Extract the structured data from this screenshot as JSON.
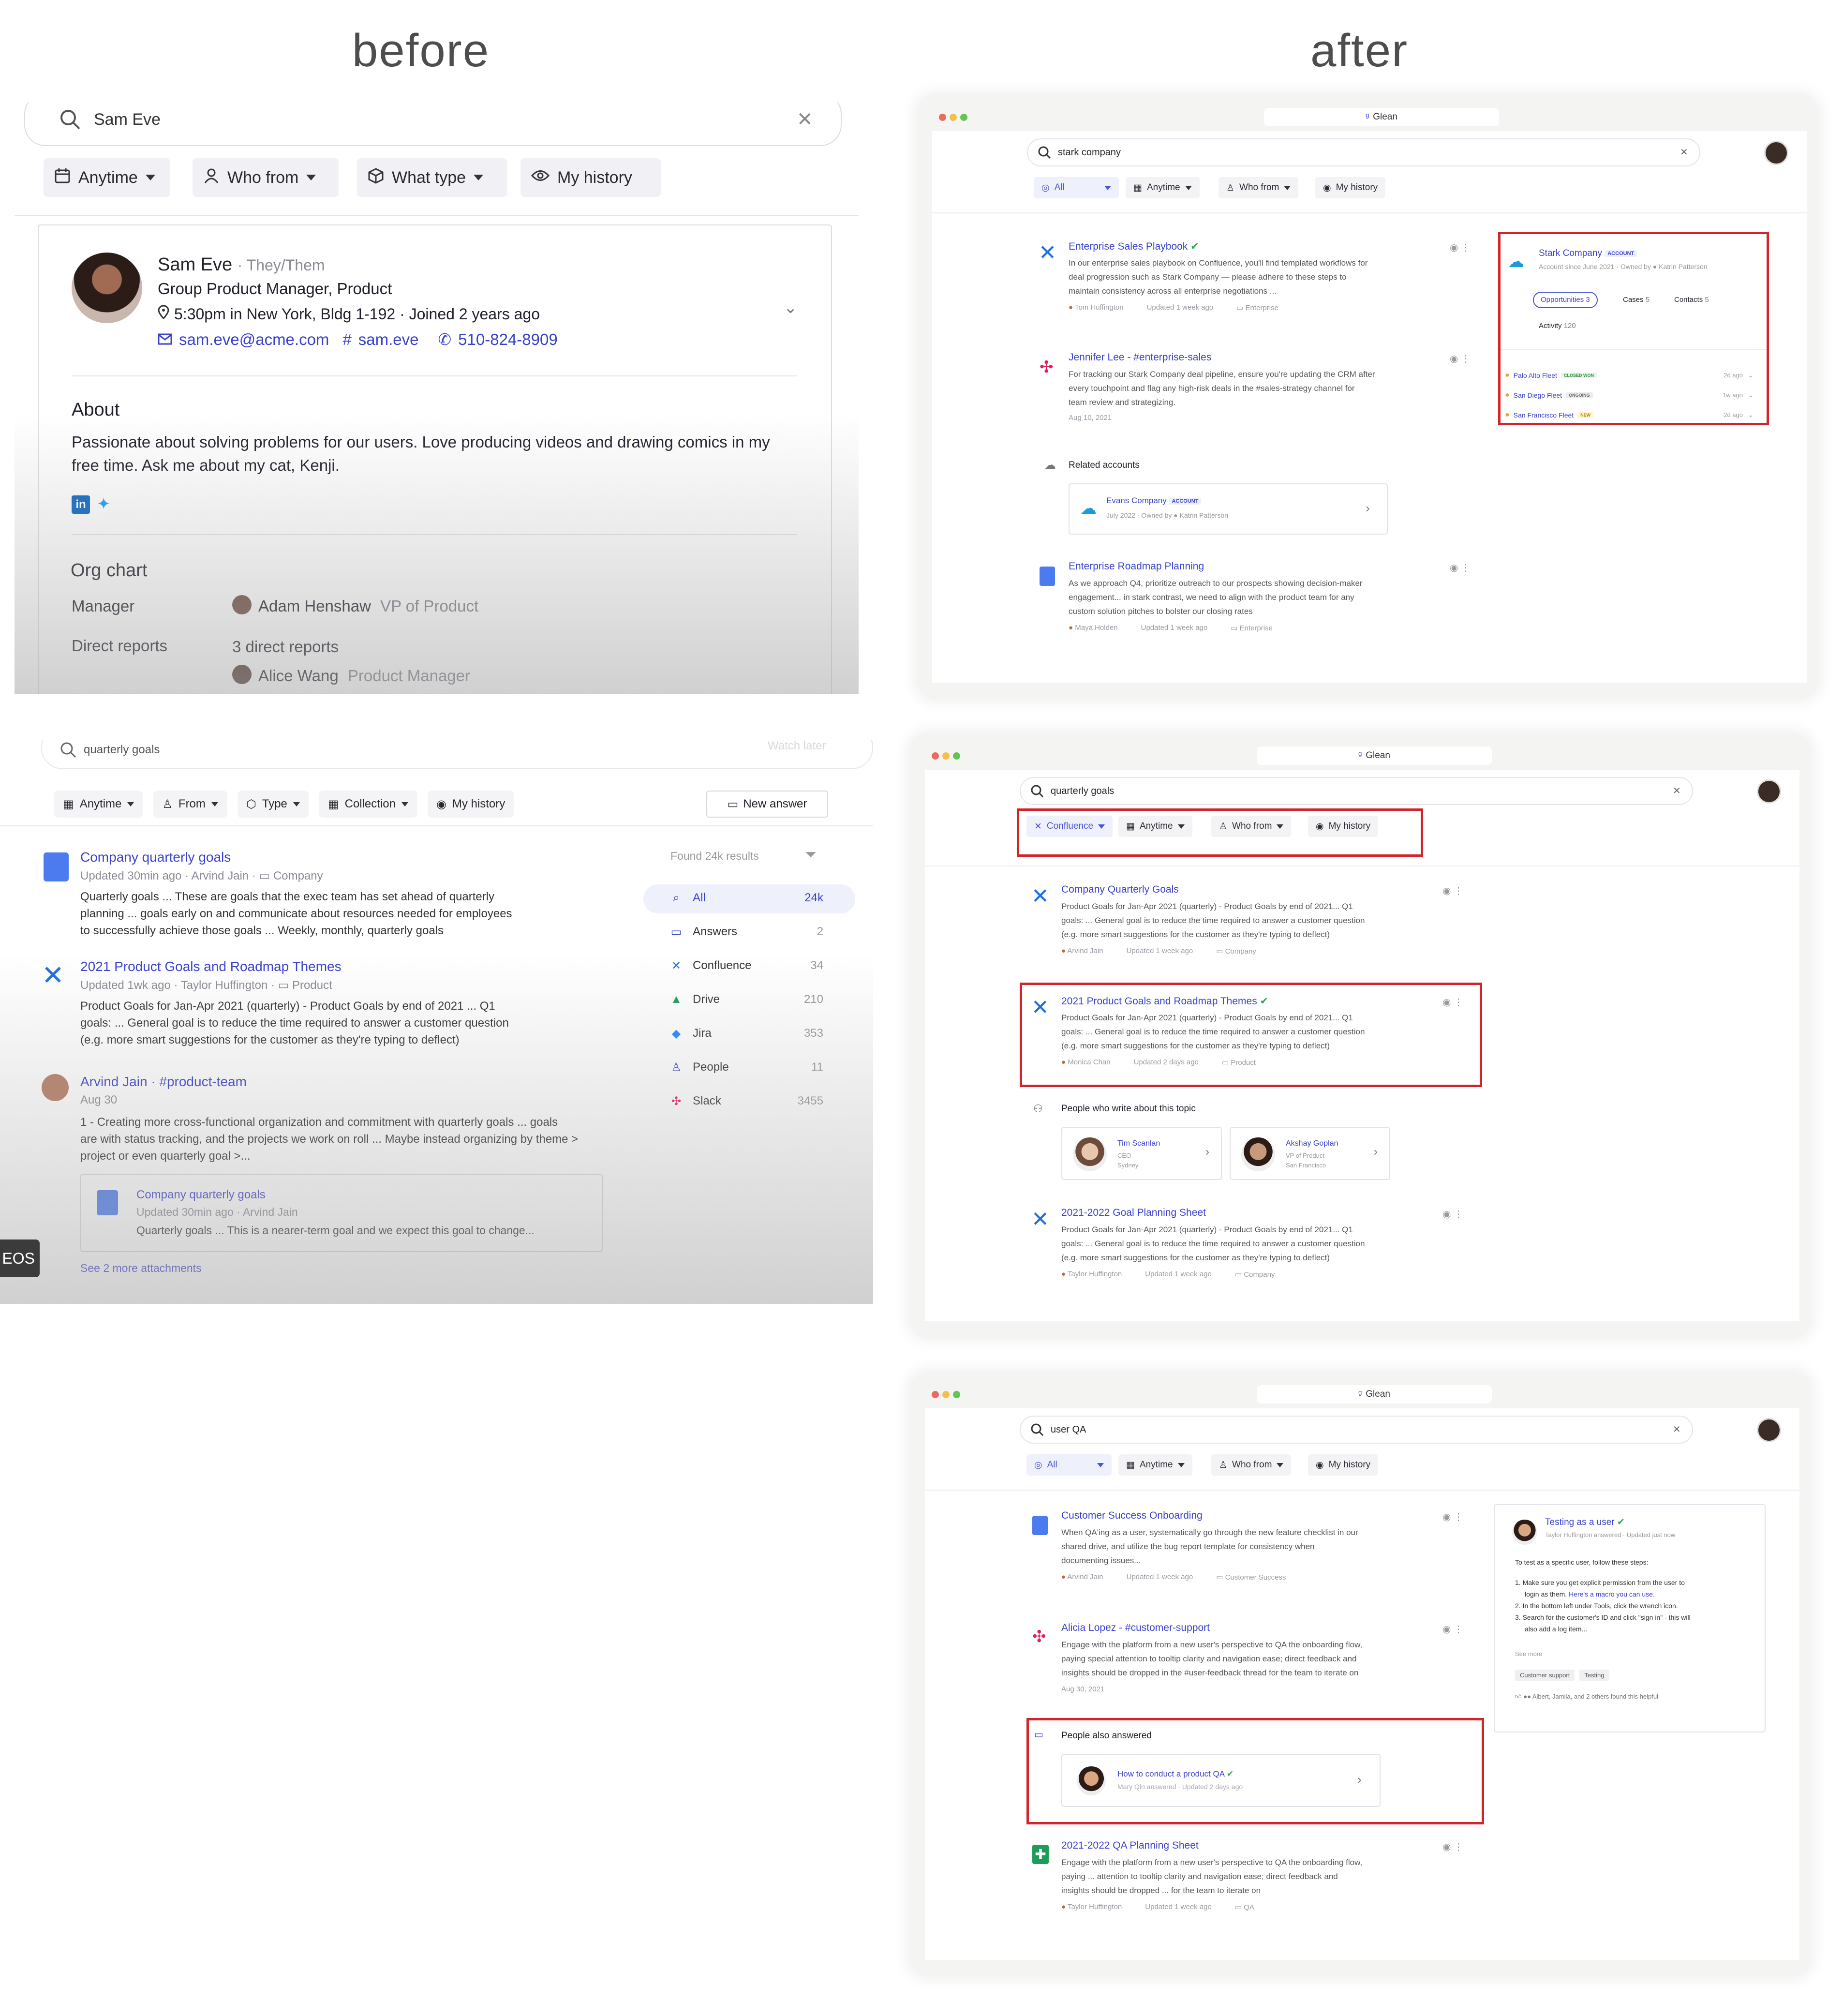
{
  "headings": {
    "before": "before",
    "after": "after"
  },
  "before1": {
    "search_value": "Sam Eve",
    "chips": [
      "Anytime",
      "Who from",
      "What type",
      "My history"
    ],
    "profile": {
      "name": "Sam Eve",
      "pronouns": "· They/Them",
      "title": "Group Product Manager, Product",
      "location": "5:30pm in New York, Bldg 1-192 · Joined 2 years ago",
      "email": "sam.eve@acme.com",
      "slack": "sam.eve",
      "phone": "510-824-8909"
    },
    "about_heading": "About",
    "about_text": "Passionate about solving problems for our users. Love producing videos and drawing comics in my free time. Ask me about my cat, Kenji.",
    "org_heading": "Org chart",
    "manager_label": "Manager",
    "manager_name": "Adam Henshaw",
    "manager_role": "VP of Product",
    "reports_label": "Direct reports",
    "reports_count": "3 direct reports",
    "report1_name": "Alice Wang",
    "report1_role": "Product Manager"
  },
  "before2": {
    "search_value": "quarterly goals",
    "overlay_text": "Watch later",
    "chips": [
      "Anytime",
      "From",
      "Type",
      "Collection",
      "My history"
    ],
    "new_answer": "New answer",
    "found": "Found 24k results",
    "facets": [
      {
        "label": "All",
        "count": "24k"
      },
      {
        "label": "Answers",
        "count": "2"
      },
      {
        "label": "Confluence",
        "count": "34"
      },
      {
        "label": "Drive",
        "count": "210"
      },
      {
        "label": "Jira",
        "count": "353"
      },
      {
        "label": "People",
        "count": "11"
      },
      {
        "label": "Slack",
        "count": "3455"
      }
    ],
    "r1_title": "Company quarterly goals",
    "r1_meta": "Updated 30min ago · ",
    "r1_author": "Arvind Jain",
    "r1_folder": "Company",
    "r1_line1": "Quarterly goals ... These are goals that the exec team has set ahead of quarterly",
    "r1_line2": "planning ... goals early on and communicate about resources needed for employees",
    "r1_line3": "to successfully achieve those goals ... Weekly, monthly, quarterly goals",
    "r2_title": "2021 Product Goals and Roadmap Themes",
    "r2_meta": "Updated 1wk ago · ",
    "r2_author": "Taylor Huffington",
    "r2_folder": "Product",
    "r2_line1": "Product Goals for Jan-Apr 2021 (quarterly) - Product Goals by end of 2021 ... Q1",
    "r2_line2": "goals: ... General goal is to reduce the time required to answer a customer question",
    "r2_line3": "(e.g. more smart suggestions for the customer as they're typing to deflect)",
    "r3_title": "Arvind Jain · #product-team",
    "r3_date": "Aug 30",
    "r3_line1": "1 - Creating more cross-functional organization and commitment with quarterly goals ... goals",
    "r3_line2": "are with status tracking, and the projects we work on roll ... Maybe instead organizing by theme >",
    "r3_line3": "project or even quarterly goal >...",
    "sub_title": "Company quarterly goals",
    "sub_meta": "Updated 30min ago · ",
    "sub_author": "Arvind Jain",
    "sub_line": "Quarterly goals ... This is a nearer-term goal and we expect this goal to change...",
    "see_more": "See 2 more attachments",
    "eos": "EOS"
  },
  "after1": {
    "url": "Glean",
    "search_value": "stark company",
    "chips": [
      "All",
      "Anytime",
      "Who from",
      "My history"
    ],
    "results": [
      {
        "title": "Enterprise Sales Playbook",
        "lines": [
          "In our enterprise sales playbook on Confluence, you'll find templated workflows for",
          "deal progression such as Stark Company — please adhere to these steps to",
          "maintain consistency across all enterprise negotiations ..."
        ],
        "author": "Tom Huffington",
        "updated": "Updated 1 week ago",
        "folder": "Enterprise"
      },
      {
        "title": "Jennifer Lee - #enterprise-sales",
        "lines": [
          "For tracking our Stark Company deal pipeline, ensure you're updating the CRM after",
          "every touchpoint and flag any high-risk deals in the #sales-strategy channel for",
          "team review and strategizing."
        ],
        "date": "Aug 10, 2021"
      },
      {
        "title": "Enterprise Roadmap Planning",
        "lines": [
          "As we approach Q4, prioritize outreach to our prospects showing decision-maker",
          "engagement... in stark contrast, we need to align with the product team for any",
          "custom solution pitches to bolster our closing rates"
        ],
        "author": "Maya Holden",
        "updated": "Updated 1 week ago",
        "folder": "Enterprise"
      }
    ],
    "related_heading": "Related accounts",
    "related_name": "Evans Company",
    "related_tag": "ACCOUNT",
    "related_meta": "July 2022 · Owned by",
    "related_owner": "Katrin Patterson",
    "panel": {
      "name": "Stark Company",
      "tag": "ACCOUNT",
      "meta": "Account since June 2021 · Owned by",
      "owner": "Katrin Patterson",
      "tabs": [
        {
          "label": "Opportunities",
          "count": "3"
        },
        {
          "label": "Cases",
          "count": "5"
        },
        {
          "label": "Contacts",
          "count": "5"
        },
        {
          "label": "Activity",
          "count": "120"
        }
      ],
      "items": [
        {
          "name": "Palo Alto Fleet",
          "tag": "CLOSED WON",
          "time": "2d ago",
          "color": "#e9f7ea",
          "text": "#2e8b3a"
        },
        {
          "name": "San Diego Fleet",
          "tag": "ONGOING",
          "time": "1w ago",
          "color": "#ececf0",
          "text": "#666"
        },
        {
          "name": "San Francisco Fleet",
          "tag": "NEW",
          "time": "2d ago",
          "color": "#fff5cc",
          "text": "#a57a00"
        }
      ]
    }
  },
  "after2": {
    "url": "Glean",
    "search_value": "quarterly goals",
    "chips": [
      "Confluence",
      "Anytime",
      "Who from",
      "My history"
    ],
    "results": [
      {
        "title": "Company Quarterly Goals",
        "lines": [
          "Product Goals for Jan-Apr 2021 (quarterly) - Product Goals by end of 2021... Q1",
          "goals: ... General goal is to reduce the time required to answer a customer question",
          "(e.g. more smart suggestions for the customer as they're typing to deflect)"
        ],
        "author": "Arvind Jain",
        "updated": "Updated 1 week ago",
        "folder": "Company"
      },
      {
        "title": "2021 Product Goals and Roadmap Themes",
        "lines": [
          "Product Goals for Jan-Apr 2021 (quarterly) - Product Goals by end of 2021... Q1",
          "goals: ... General goal is to reduce the time required to answer a customer question",
          "(e.g. more smart suggestions for the customer as they're typing to deflect)"
        ],
        "author": "Monica Chan",
        "updated": "Updated 2 days ago",
        "folder": "Product"
      },
      {
        "title": "2021-2022 Goal Planning Sheet",
        "lines": [
          "Product Goals for Jan-Apr 2021 (quarterly) - Product Goals by end of 2021... Q1",
          "goals: ... General goal is to reduce the time required to answer a customer question",
          "(e.g. more smart suggestions for the customer as they're typing to deflect)"
        ],
        "author": "Taylor Huffington",
        "updated": "Updated 1 week ago",
        "folder": "Company"
      }
    ],
    "people_heading": "People who write about this topic",
    "people": [
      {
        "name": "Tim Scanlan",
        "role": "CEO",
        "loc": "Sydney"
      },
      {
        "name": "Akshay Goplan",
        "role": "VP of Product",
        "loc": "San Francisco"
      }
    ]
  },
  "after3": {
    "url": "Glean",
    "search_value": "user QA",
    "chips": [
      "All",
      "Anytime",
      "Who from",
      "My history"
    ],
    "results": [
      {
        "title": "Customer Success Onboarding",
        "lines": [
          "When QA'ing as a user, systematically go through the new feature checklist in our",
          "shared drive, and utilize the bug report template for consistency when",
          "documenting issues..."
        ],
        "author": "Arvind Jain",
        "updated": "Updated 1 week ago",
        "folder": "Customer Success"
      },
      {
        "title": "Alicia Lopez - #customer-support",
        "lines": [
          "Engage with the platform from a new user's perspective to QA the onboarding flow,",
          "paying special attention to tooltip clarity and navigation ease; direct feedback and",
          "insights should be dropped in the #user-feedback thread for the team to iterate on"
        ],
        "date": "Aug 30, 2021"
      },
      {
        "title": "2021-2022 QA Planning Sheet",
        "lines": [
          "Engage with the platform from a new user's perspective to QA the onboarding flow,",
          "paying ... attention to tooltip clarity and navigation ease; direct feedback and",
          "insights should be dropped ... for the team to iterate on"
        ],
        "author": "Taylor Huffington",
        "updated": "Updated 1 week ago",
        "folder": "QA"
      }
    ],
    "also_heading": "People also answered",
    "also_title": "How to conduct a product QA",
    "also_meta": "Mary Qin answered · Updated 2 days ago",
    "answer": {
      "title": "Testing as a user",
      "meta": "Taylor Huffington answered · Updated just now",
      "intro": "To test as a specific user, follow these steps:",
      "step1a": "1.  Make sure you get explicit permission from the user to",
      "step1b": "login as them. ",
      "step1link": "Here's a macro you can use.",
      "step2": "2.  In the bottom left under Tools, click the wrench icon.",
      "step3a": "3.  Search for the customer's ID and click \"sign in\" - this will",
      "step3b": "also add a log item...",
      "see_more": "See more",
      "tags": [
        "Customer support",
        "Testing"
      ],
      "helpful": "Albert, Jamila, and 2 others found this helpful"
    }
  }
}
